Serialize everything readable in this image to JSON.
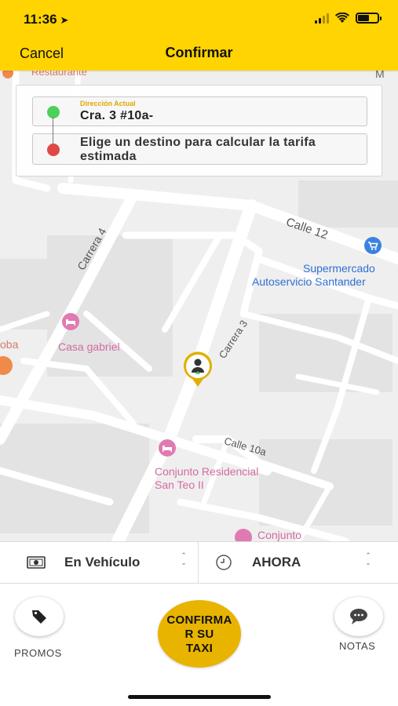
{
  "status_bar": {
    "time": "11:36",
    "battery_level": 0.6
  },
  "nav": {
    "cancel_label": "Cancel",
    "title": "Confirmar"
  },
  "address": {
    "current_caption": "Dirección Actual",
    "current_value": "Cra. 3 #10a-",
    "destination_placeholder": "Elige un destino para calcular la tarifa estimada"
  },
  "map": {
    "streets": {
      "carrera_4": "Carrera 4",
      "calle_12": "Calle 12",
      "carrera_3": "Carrera 3",
      "calle_10a": "Calle 10a"
    },
    "places": {
      "restaurante": "Restaurante",
      "supermercado_line1": "Supermercado",
      "supermercado_line2": "Autoservicio Santander",
      "casa_gabriel": "Casa gabriel",
      "oba": "oba",
      "conjunto_line1": "Conjunto Residencial",
      "conjunto_line2": "San Teo II",
      "conjunto2": "Conjunto"
    },
    "icons": [
      "pink-hotel-icon",
      "blue-cart-icon",
      "orange-restaurant-icon"
    ]
  },
  "selector": {
    "payment": "En Vehículo",
    "time": "AHORA"
  },
  "actions": {
    "promos_label": "PROMOS",
    "confirm_label": "CONFIRMA\nR SU\nTAXI",
    "notas_label": "NOTAS"
  },
  "colors": {
    "brand_yellow": "#FFD400",
    "confirm_yellow": "#E8B400",
    "current_dot": "#4CD15A",
    "destination_dot": "#E04848",
    "poi_pink": "#D46AA3",
    "poi_blue": "#2E6FD6"
  }
}
